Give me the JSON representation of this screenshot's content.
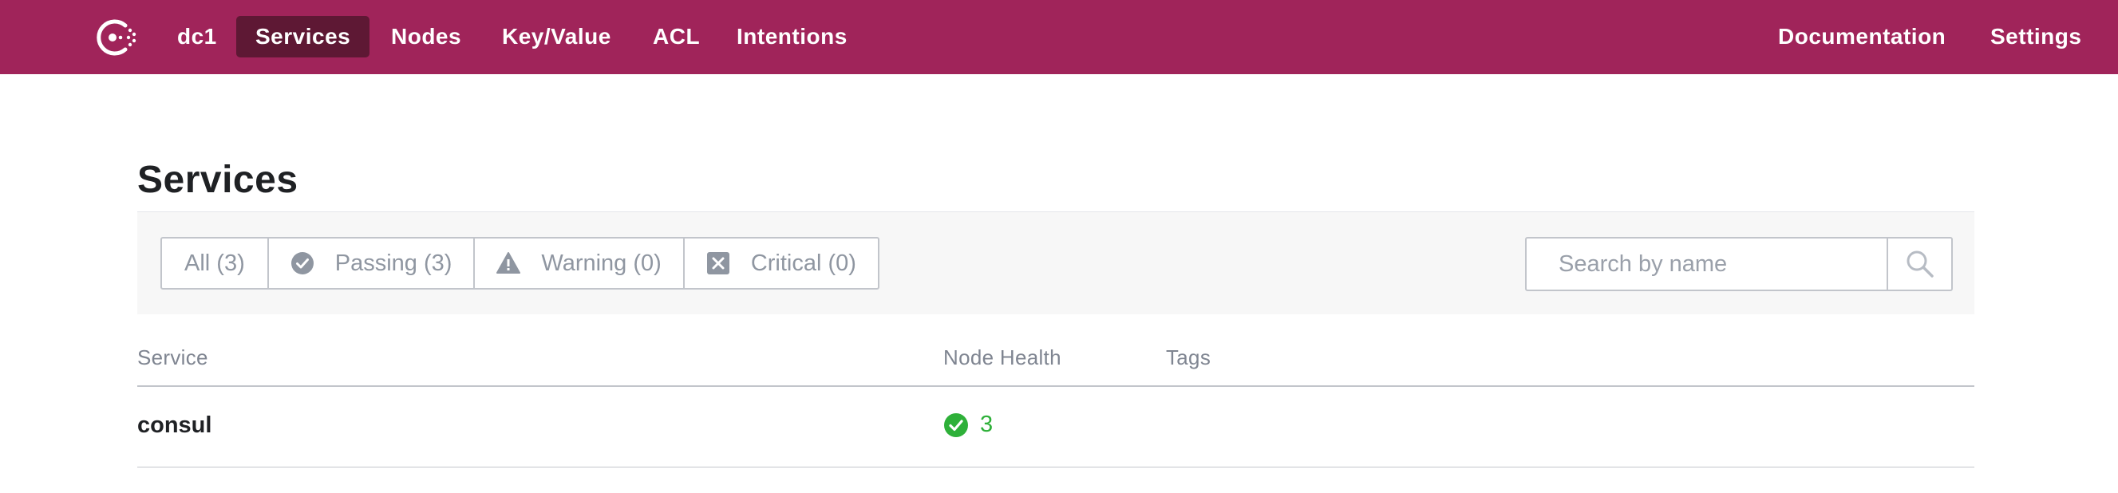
{
  "nav": {
    "datacenter": "dc1",
    "items": [
      {
        "label": "Services",
        "active": true
      },
      {
        "label": "Nodes"
      },
      {
        "label": "Key/Value"
      },
      {
        "label": "ACL"
      },
      {
        "label": "Intentions"
      }
    ],
    "right": [
      {
        "label": "Documentation"
      },
      {
        "label": "Settings"
      }
    ]
  },
  "page": {
    "title": "Services"
  },
  "filters": [
    {
      "label": "All (3)",
      "icon": "none"
    },
    {
      "label": "Passing (3)",
      "icon": "check-circle-icon"
    },
    {
      "label": "Warning (0)",
      "icon": "warning-icon"
    },
    {
      "label": "Critical (0)",
      "icon": "critical-x-icon"
    }
  ],
  "search": {
    "placeholder": "Search by name"
  },
  "table": {
    "headers": [
      "Service",
      "Node Health",
      "Tags"
    ],
    "rows": [
      {
        "service": "consul",
        "health_count": "3",
        "tags": ""
      }
    ]
  },
  "colors": {
    "brand": "#a0245a",
    "nav_active": "#5e1834",
    "passing": "#2eb039",
    "muted": "#8f96a1"
  }
}
